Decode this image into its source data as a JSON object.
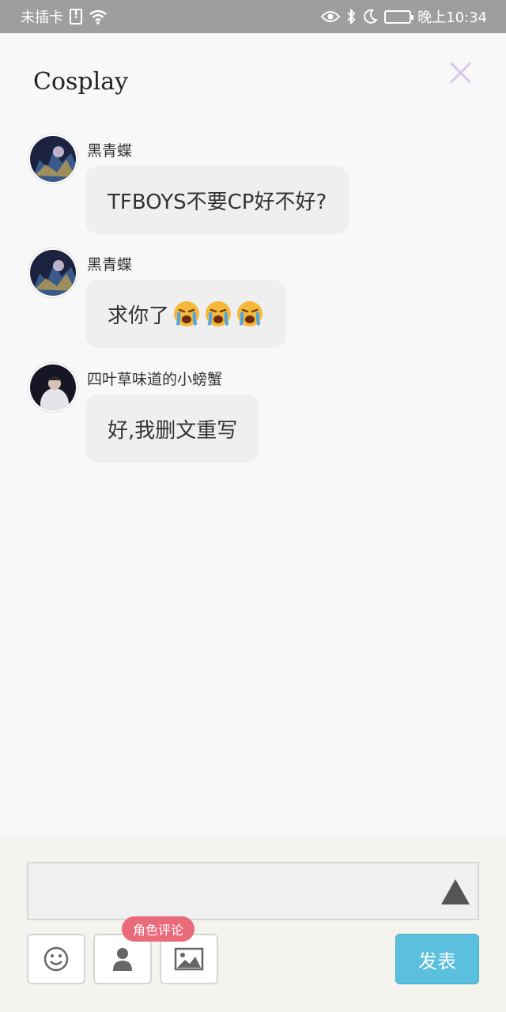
{
  "status_bar": {
    "carrier": "未插卡",
    "time": "晚上10:34",
    "icons": [
      "sim-alert-icon",
      "wifi-icon",
      "eye-icon",
      "bluetooth-icon",
      "moon-icon",
      "battery-icon"
    ]
  },
  "header": {
    "title": "Cosplay",
    "close_icon": "close-icon"
  },
  "messages": [
    {
      "author": "黑青蝶",
      "text": "TFBOYS不要CP好不好?",
      "emojis": 0
    },
    {
      "author": "黑青蝶",
      "text": "求你了",
      "emojis": 3
    },
    {
      "author": "四叶草味道的小螃蟹",
      "text": "好,我删文重写",
      "emojis": 0
    }
  ],
  "composer": {
    "input_value": "",
    "role_badge": "角色评论",
    "post_label": "发表",
    "tool_icons": [
      "smile-icon",
      "person-icon",
      "image-icon"
    ],
    "colors": {
      "post_button": "#5bc0de",
      "badge": "#e96b7a",
      "close_icon": "#d7c8ec"
    }
  }
}
